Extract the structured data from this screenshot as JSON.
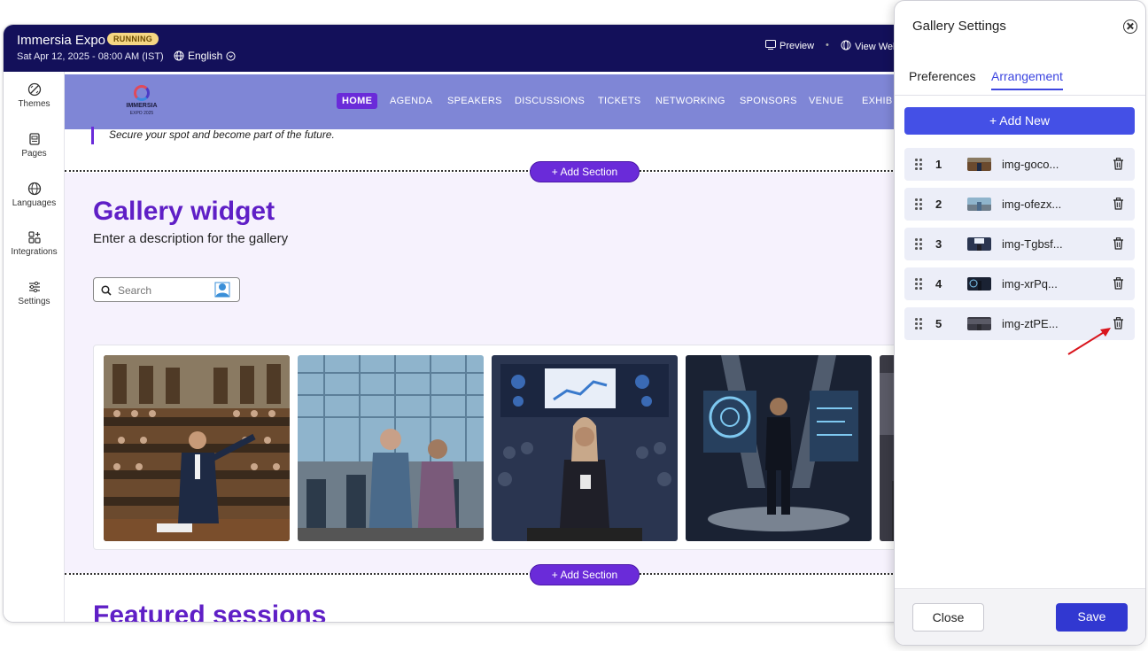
{
  "app": {
    "title": "Immersia Expo",
    "status_badge": "RUNNING",
    "datetime": "Sat Apr 12, 2025 - 08:00 AM (IST)",
    "language": "English",
    "preview_label": "Preview",
    "view_website_label": "View Wel"
  },
  "sidebar": {
    "items": [
      {
        "label": "Themes",
        "icon": "palette-icon"
      },
      {
        "label": "Pages",
        "icon": "pages-icon"
      },
      {
        "label": "Languages",
        "icon": "globe-icon"
      },
      {
        "label": "Integrations",
        "icon": "integrations-icon"
      },
      {
        "label": "Settings",
        "icon": "sliders-icon"
      }
    ]
  },
  "site": {
    "logo_text": "IMMERSIA",
    "logo_sub": "EXPO 2025",
    "nav": [
      "HOME",
      "AGENDA",
      "SPEAKERS",
      "DISCUSSIONS",
      "TICKETS",
      "NETWORKING",
      "SPONSORS",
      "VENUE",
      "EXHIB"
    ],
    "tagline": "Secure your spot and become part of the future.",
    "add_section_label": "+ Add Section",
    "gallery": {
      "title": "Gallery widget",
      "description": "Enter a description for the gallery",
      "search_placeholder": "Search"
    },
    "featured_title": "Featured sessions"
  },
  "panel": {
    "title": "Gallery Settings",
    "tabs": [
      "Preferences",
      "Arrangement"
    ],
    "active_tab": "Arrangement",
    "add_new_label": "+  Add New",
    "images": [
      {
        "index": "1",
        "name": "img-goco..."
      },
      {
        "index": "2",
        "name": "img-ofezx..."
      },
      {
        "index": "3",
        "name": "img-Tgbsf..."
      },
      {
        "index": "4",
        "name": "img-xrPq..."
      },
      {
        "index": "5",
        "name": "img-ztPE..."
      }
    ],
    "close_label": "Close",
    "save_label": "Save"
  },
  "colors": {
    "topbar": "#13105a",
    "accent_purple": "#6a2bd9",
    "panel_blue": "#4450e6",
    "annotation_arrow": "#d9151d"
  }
}
